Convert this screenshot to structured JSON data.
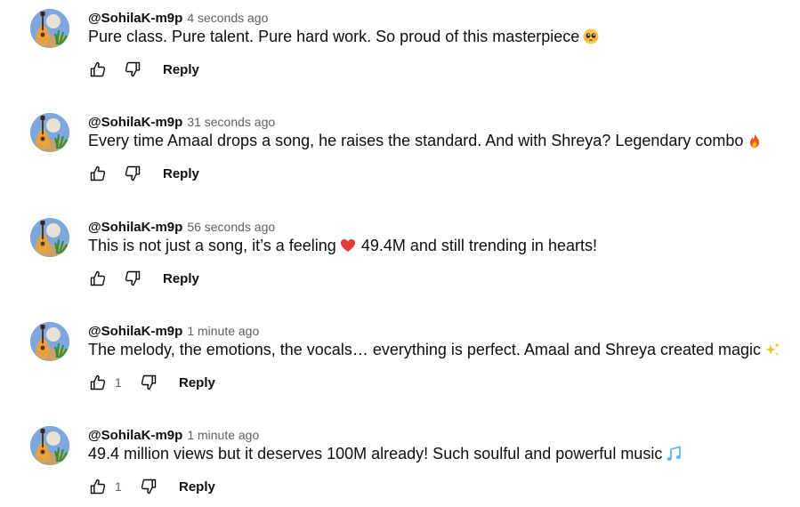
{
  "comments": [
    {
      "author": "@SohilaK-m9p",
      "time": "4 seconds ago",
      "text": "Pure class. Pure talent. Pure hard work. So proud of this masterpiece",
      "emoji": "pleading-face-icon",
      "likes": "",
      "reply_label": "Reply"
    },
    {
      "author": "@SohilaK-m9p",
      "time": "31 seconds ago",
      "text": "Every time Amaal drops a song, he raises the standard. And with Shreya? Legendary combo",
      "emoji": "fire-icon",
      "likes": "",
      "reply_label": "Reply"
    },
    {
      "author": "@SohilaK-m9p",
      "time": "56 seconds ago",
      "text_before": "This is not just a song, it’s a feeling",
      "emoji": "red-heart-icon",
      "text_after": "49.4M and still trending in hearts!",
      "likes": "",
      "reply_label": "Reply"
    },
    {
      "author": "@SohilaK-m9p",
      "time": "1 minute ago",
      "text": "The melody, the emotions, the vocals… everything is perfect. Amaal and Shreya created magic",
      "emoji": "sparkles-icon",
      "likes": "1",
      "reply_label": "Reply"
    },
    {
      "author": "@SohilaK-m9p",
      "time": "1 minute ago",
      "text": "49.4 million views but it deserves 100M already! Such soulful and powerful music",
      "emoji": "musical-notes-icon",
      "likes": "1",
      "reply_label": "Reply"
    }
  ],
  "colors": {
    "text": "#0f0f0f",
    "secondary_text": "#606060",
    "avatar_bg": "#7ea7e0"
  }
}
